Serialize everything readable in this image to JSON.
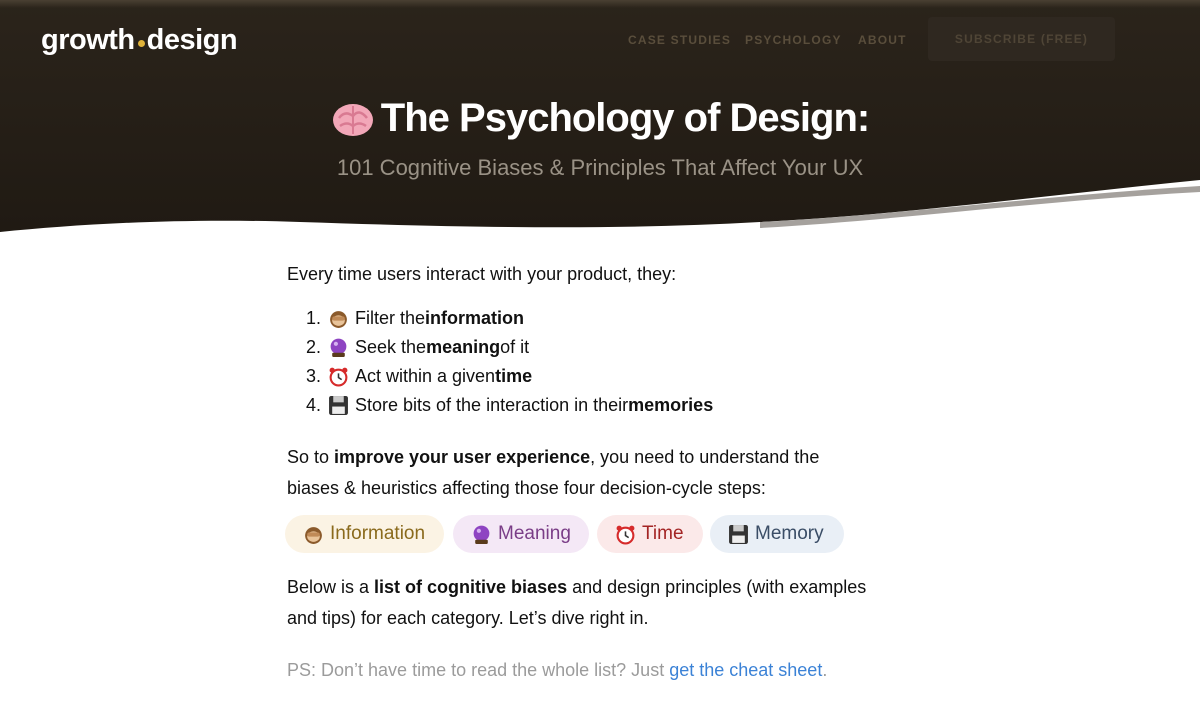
{
  "header": {
    "logo_left": "growth",
    "logo_right": "design",
    "nav": [
      "CASE STUDIES",
      "PSYCHOLOGY",
      "ABOUT"
    ],
    "subscribe_label": "SUBSCRIBE (FREE)",
    "hero_title": "The Psychology of Design:",
    "hero_subtitle": "101 Cognitive Biases & Principles That Affect Your UX",
    "title_icon": "brain-emoji"
  },
  "intro": "Every time users interact with your product, they:",
  "steps": [
    {
      "num": "1.",
      "icon": "see-no-evil-monkey",
      "pre": "Filter the ",
      "bold": "information",
      "post": ""
    },
    {
      "num": "2.",
      "icon": "crystal-ball",
      "pre": "Seek the ",
      "bold": "meaning",
      "post": " of it"
    },
    {
      "num": "3.",
      "icon": "alarm-clock",
      "pre": "Act within a given ",
      "bold": "time",
      "post": ""
    },
    {
      "num": "4.",
      "icon": "floppy-disk",
      "pre": "Store bits of the interaction in their ",
      "bold": "memories",
      "post": ""
    }
  ],
  "para1": {
    "pre": "So to ",
    "bold": "improve your user experience",
    "post": ", you need to understand the biases & heuristics affecting those four decision-cycle steps:"
  },
  "chips": [
    {
      "label": "Information",
      "icon": "see-no-evil-monkey",
      "bg": "#fbf3e4",
      "color": "#8a6a1c"
    },
    {
      "label": "Meaning",
      "icon": "crystal-ball",
      "bg": "#f4e8f6",
      "color": "#7a3d87"
    },
    {
      "label": "Time",
      "icon": "alarm-clock",
      "bg": "#fbe9e9",
      "color": "#a32424"
    },
    {
      "label": "Memory",
      "icon": "floppy-disk",
      "bg": "#e9eff6",
      "color": "#3a4d66"
    }
  ],
  "para2": {
    "pre": "Below is a ",
    "bold": "list of cognitive biases",
    "post": " and design principles (with examples and tips) for each category. Let’s dive right in."
  },
  "ps": {
    "text": "PS: Don’t have time to read the whole list? Just ",
    "link": "get the cheat sheet",
    "end": "."
  },
  "colors": {
    "hero_bg": "#221c15",
    "accent_dot": "#e0b33a",
    "link": "#3b82d6"
  }
}
